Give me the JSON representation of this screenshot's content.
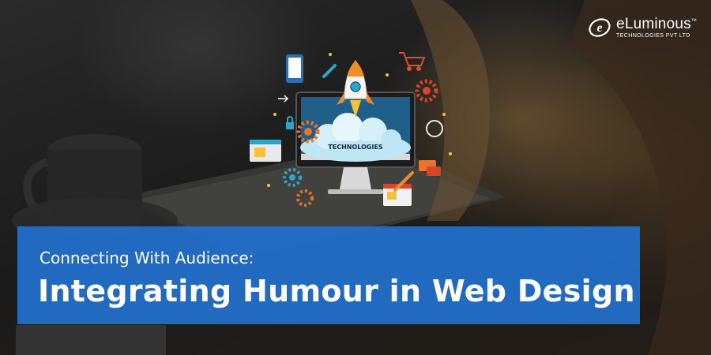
{
  "brand": {
    "name": "eLuminous",
    "trademark": "™",
    "tagline": "TECHNOLOGIES PVT LTD",
    "mark_letter": "e"
  },
  "headline": {
    "subtitle": "Connecting With Audience:",
    "title": "Integrating Humour in Web Design"
  },
  "illustration": {
    "monitor_label": "TECHNOLOGIES"
  },
  "colors": {
    "title_box": "#2270CD",
    "text": "#FFFFFF",
    "rocket_orange": "#F28C28",
    "gear_orange": "#E8732A",
    "gear_red": "#D9452B",
    "gear_teal": "#2BA6C9",
    "cloud": "#BFE6F5"
  }
}
